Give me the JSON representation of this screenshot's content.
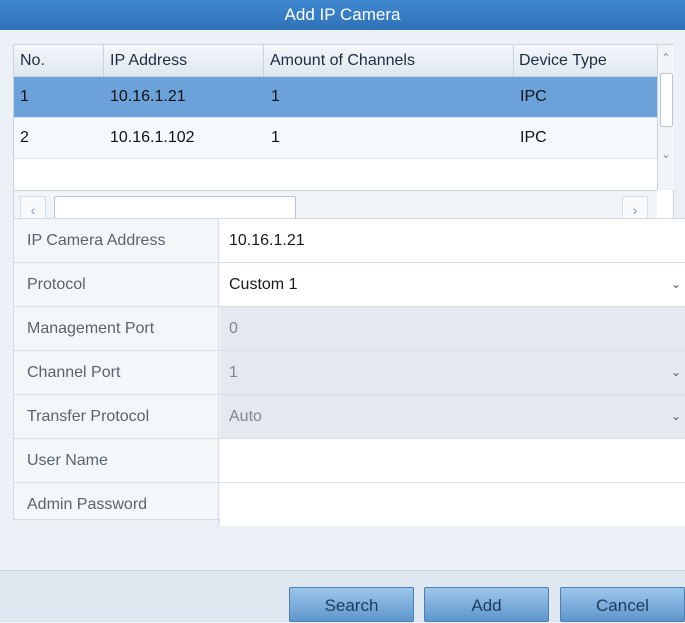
{
  "dialog": {
    "title": "Add IP Camera"
  },
  "device_table": {
    "columns": [
      "No.",
      "IP Address",
      "Amount of Channels",
      "Device Type"
    ],
    "rows": [
      {
        "no": "1",
        "ip": "10.16.1.21",
        "channels": "1",
        "type": "IPC",
        "selected": true
      },
      {
        "no": "2",
        "ip": "10.16.1.102",
        "channels": "1",
        "type": "IPC",
        "selected": false
      }
    ]
  },
  "form": {
    "fields": [
      {
        "label": "IP Camera Address",
        "value": "10.16.1.21"
      },
      {
        "label": "Protocol",
        "value": "Custom 1"
      },
      {
        "label": "Management Port",
        "value": "0"
      },
      {
        "label": "Channel Port",
        "value": "1"
      },
      {
        "label": "Transfer Protocol",
        "value": "Auto"
      },
      {
        "label": "User Name",
        "value": ""
      },
      {
        "label": "Admin Password",
        "value": ""
      }
    ]
  },
  "buttons": {
    "search": "Search",
    "add": "Add",
    "cancel": "Cancel"
  },
  "icons": {
    "scroll_up": "chevron-up-icon",
    "scroll_down": "chevron-down-icon",
    "scroll_left": "chevron-left-icon",
    "scroll_right": "chevron-right-icon",
    "dropdown": "chevron-down-icon"
  },
  "colors": {
    "title_bar": "#3a80c6",
    "selected_row": "#6aa2d9",
    "button": "#7fb0df"
  }
}
